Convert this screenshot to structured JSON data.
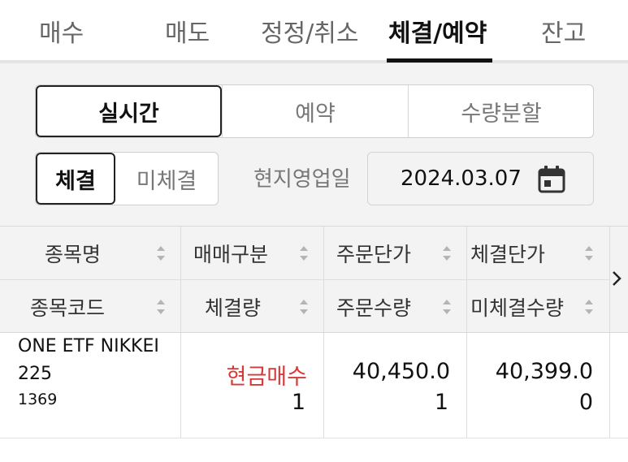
{
  "tabs": [
    {
      "label": "매수"
    },
    {
      "label": "매도"
    },
    {
      "label": "정정/취소"
    },
    {
      "label": "체결/예약",
      "active": true
    },
    {
      "label": "잔고"
    }
  ],
  "mode_segments": [
    {
      "label": "실시간",
      "active": true
    },
    {
      "label": "예약"
    },
    {
      "label": "수량분할"
    }
  ],
  "exec_segments": [
    {
      "label": "체결",
      "active": true
    },
    {
      "label": "미체결"
    }
  ],
  "date_filter": {
    "label": "현지영업일",
    "value": "2024.03.07",
    "icon": "calendar-icon"
  },
  "table": {
    "headers_row1": [
      "종목명",
      "매매구분",
      "주문단가",
      "체결단가"
    ],
    "headers_row2": [
      "종목코드",
      "체결량",
      "주문수량",
      "미체결수량"
    ],
    "rows": [
      {
        "name_line1": "ONE ETF NIKKEI",
        "name_line2": "225",
        "code": "1369",
        "trade_type": "현금매수",
        "exec_qty": "1",
        "order_price": "40,450.0",
        "order_qty": "1",
        "exec_price": "40,399.0",
        "unexec_qty": "0"
      }
    ]
  },
  "colors": {
    "buy": "#d43a3a",
    "active_text": "#111111",
    "inactive_text": "#777777",
    "panel_bg": "#f3f3f3"
  },
  "icons": {
    "sort": "sort-icon",
    "next": "chevron-right-icon"
  }
}
